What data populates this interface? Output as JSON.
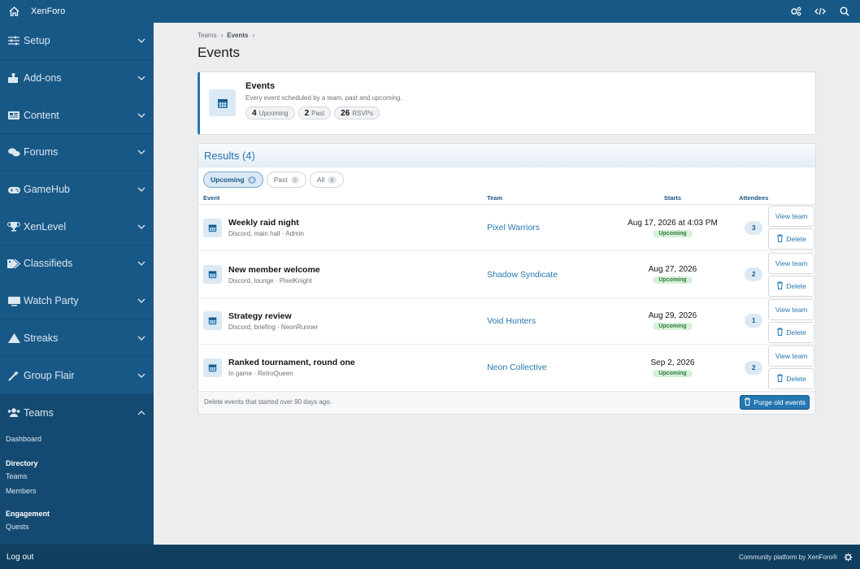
{
  "topbar": {
    "brand": "XenForo",
    "icons": [
      "home-icon",
      "gears-icon",
      "code-icon",
      "search-icon"
    ]
  },
  "sidebar": {
    "items": [
      {
        "label": "Setup",
        "icon": "sliders-icon"
      },
      {
        "label": "Add-ons",
        "icon": "puzzle-icon"
      },
      {
        "label": "Content",
        "icon": "newspaper-icon"
      },
      {
        "label": "Forums",
        "icon": "comments-icon"
      },
      {
        "label": "GameHub",
        "icon": "gamepad-icon"
      },
      {
        "label": "XenLevel",
        "icon": "trophy-icon"
      },
      {
        "label": "Classifieds",
        "icon": "tags-icon"
      },
      {
        "label": "Watch Party",
        "icon": "monitor-icon"
      },
      {
        "label": "Streaks",
        "icon": "triangle-icon"
      },
      {
        "label": "Group Flair",
        "icon": "magic-wand-icon"
      },
      {
        "label": "Teams",
        "icon": "users-icon"
      }
    ],
    "teams_sub": {
      "dashboard": "Dashboard",
      "directory_heading": "Directory",
      "teams": "Teams",
      "members": "Members",
      "engagement_heading": "Engagement",
      "quests": "Quests"
    }
  },
  "breadcrumb": {
    "first": "Teams",
    "second": "Events",
    "separator": "›"
  },
  "page_title": "Events",
  "info": {
    "title": "Events",
    "description": "Every event scheduled by a team, past and upcoming.",
    "stats": [
      {
        "count": "4",
        "label": "Upcoming"
      },
      {
        "count": "2",
        "label": "Past"
      },
      {
        "count": "26",
        "label": "RSVPs"
      }
    ]
  },
  "results": {
    "heading": "Results (4)",
    "filters": [
      {
        "label": "Upcoming",
        "count": "4"
      },
      {
        "label": "Past",
        "count": "2"
      },
      {
        "label": "All",
        "count": "6"
      }
    ],
    "columns": {
      "event": "Event",
      "team": "Team",
      "starts": "Starts",
      "attendees": "Attendees"
    },
    "rows": [
      {
        "title": "Weekly raid night",
        "meta": "Discord, main hall · Admin",
        "team": "Pixel Warriors",
        "starts": "Aug 17, 2026 at 4:03 PM",
        "status": "Upcoming",
        "attendees": "3"
      },
      {
        "title": "New member welcome",
        "meta": "Discord, lounge · PixelKnight",
        "team": "Shadow Syndicate",
        "starts": "Aug 27, 2026",
        "status": "Upcoming",
        "attendees": "2"
      },
      {
        "title": "Strategy review",
        "meta": "Discord, briefing · NeonRunner",
        "team": "Void Hunters",
        "starts": "Aug 29, 2026",
        "status": "Upcoming",
        "attendees": "1"
      },
      {
        "title": "Ranked tournament, round one",
        "meta": "In game · RetroQueen",
        "team": "Neon Collective",
        "starts": "Sep 2, 2026",
        "status": "Upcoming",
        "attendees": "2"
      }
    ],
    "actions": {
      "view_team": "View team",
      "delete": "Delete"
    },
    "footer_note": "Delete events that started over 90 days ago.",
    "purge_label": "Purge old events"
  },
  "bottombar": {
    "logout": "Log out",
    "powered": "Community platform by XenForo®"
  }
}
